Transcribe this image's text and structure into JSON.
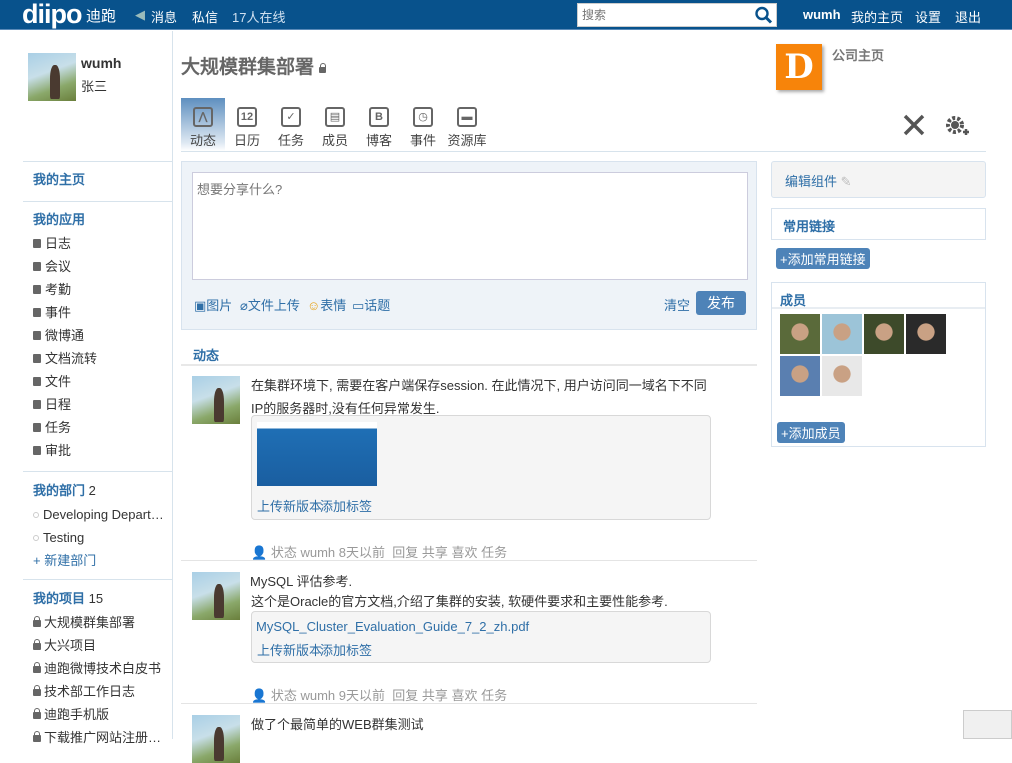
{
  "topbar": {
    "logo": "diipo",
    "brand": "迪跑",
    "messages": "消息",
    "private_msg": "私信",
    "online": "17人在线",
    "search_placeholder": "搜索",
    "user": "wumh",
    "home": "我的主页",
    "settings": "设置",
    "logout": "退出"
  },
  "profile": {
    "username": "wumh",
    "realname": "张三"
  },
  "sidebar": {
    "home": "我的主页",
    "apps_title": "我的应用",
    "apps": [
      "日志",
      "会议",
      "考勤",
      "事件",
      "微博通",
      "文档流转",
      "文件",
      "日程",
      "任务",
      "审批"
    ],
    "depts_title": "我的部门",
    "depts_count": "2",
    "depts": [
      "Developing Departm…",
      "Testing"
    ],
    "new_dept": "+ 新建部门",
    "projects_title": "我的项目",
    "projects_count": "15",
    "projects": [
      "大规模群集部署",
      "大兴项目",
      "迪跑微博技术白皮书",
      "技术部工作日志",
      "迪跑手机版",
      "下载推广网站注册信息"
    ]
  },
  "main": {
    "title": "大规模群集部署",
    "tabs": [
      {
        "label": "动态",
        "icon": "activity-icon"
      },
      {
        "label": "日历",
        "icon": "calendar-icon"
      },
      {
        "label": "任务",
        "icon": "task-icon"
      },
      {
        "label": "成员",
        "icon": "members-icon"
      },
      {
        "label": "博客",
        "icon": "blog-icon"
      },
      {
        "label": "事件",
        "icon": "clock-icon"
      },
      {
        "label": "资源库",
        "icon": "drive-icon"
      }
    ],
    "composer": {
      "placeholder": "想要分享什么?",
      "image": "图片",
      "file": "文件上传",
      "emoji": "表情",
      "topic": "话题",
      "clear": "清空",
      "publish": "发布"
    },
    "feed_title": "动态",
    "posts": [
      {
        "text": "在集群环境下, 需要在客户端保存session. 在此情况下, 用户访问同一域名下不同IP的服务器时,没有任何异常发生.",
        "upload": "上传新版本",
        "tag": "添加标签",
        "meta_type": "状态",
        "author": "wumh",
        "time": "8天以前",
        "reply": "回复",
        "share": "共享",
        "like": "喜欢",
        "task": "任务"
      },
      {
        "title": "MySQL 评估参考.",
        "text": "这个是Oracle的官方文档,介绍了集群的安装, 软硬件要求和主要性能参考.",
        "file": "MySQL_Cluster_Evaluation_Guide_7_2_zh.pdf",
        "upload": "上传新版本",
        "tag": "添加标签",
        "meta_type": "状态",
        "author": "wumh",
        "time": "9天以前",
        "reply": "回复",
        "share": "共享",
        "like": "喜欢",
        "task": "任务"
      },
      {
        "text": "做了个最简单的WEB群集测试"
      }
    ]
  },
  "right": {
    "company": "公司主页",
    "edit_widgets": "编辑组件",
    "links_title": "常用链接",
    "add_link": "+添加常用链接",
    "members_title": "成员",
    "add_member": "+添加成员"
  }
}
